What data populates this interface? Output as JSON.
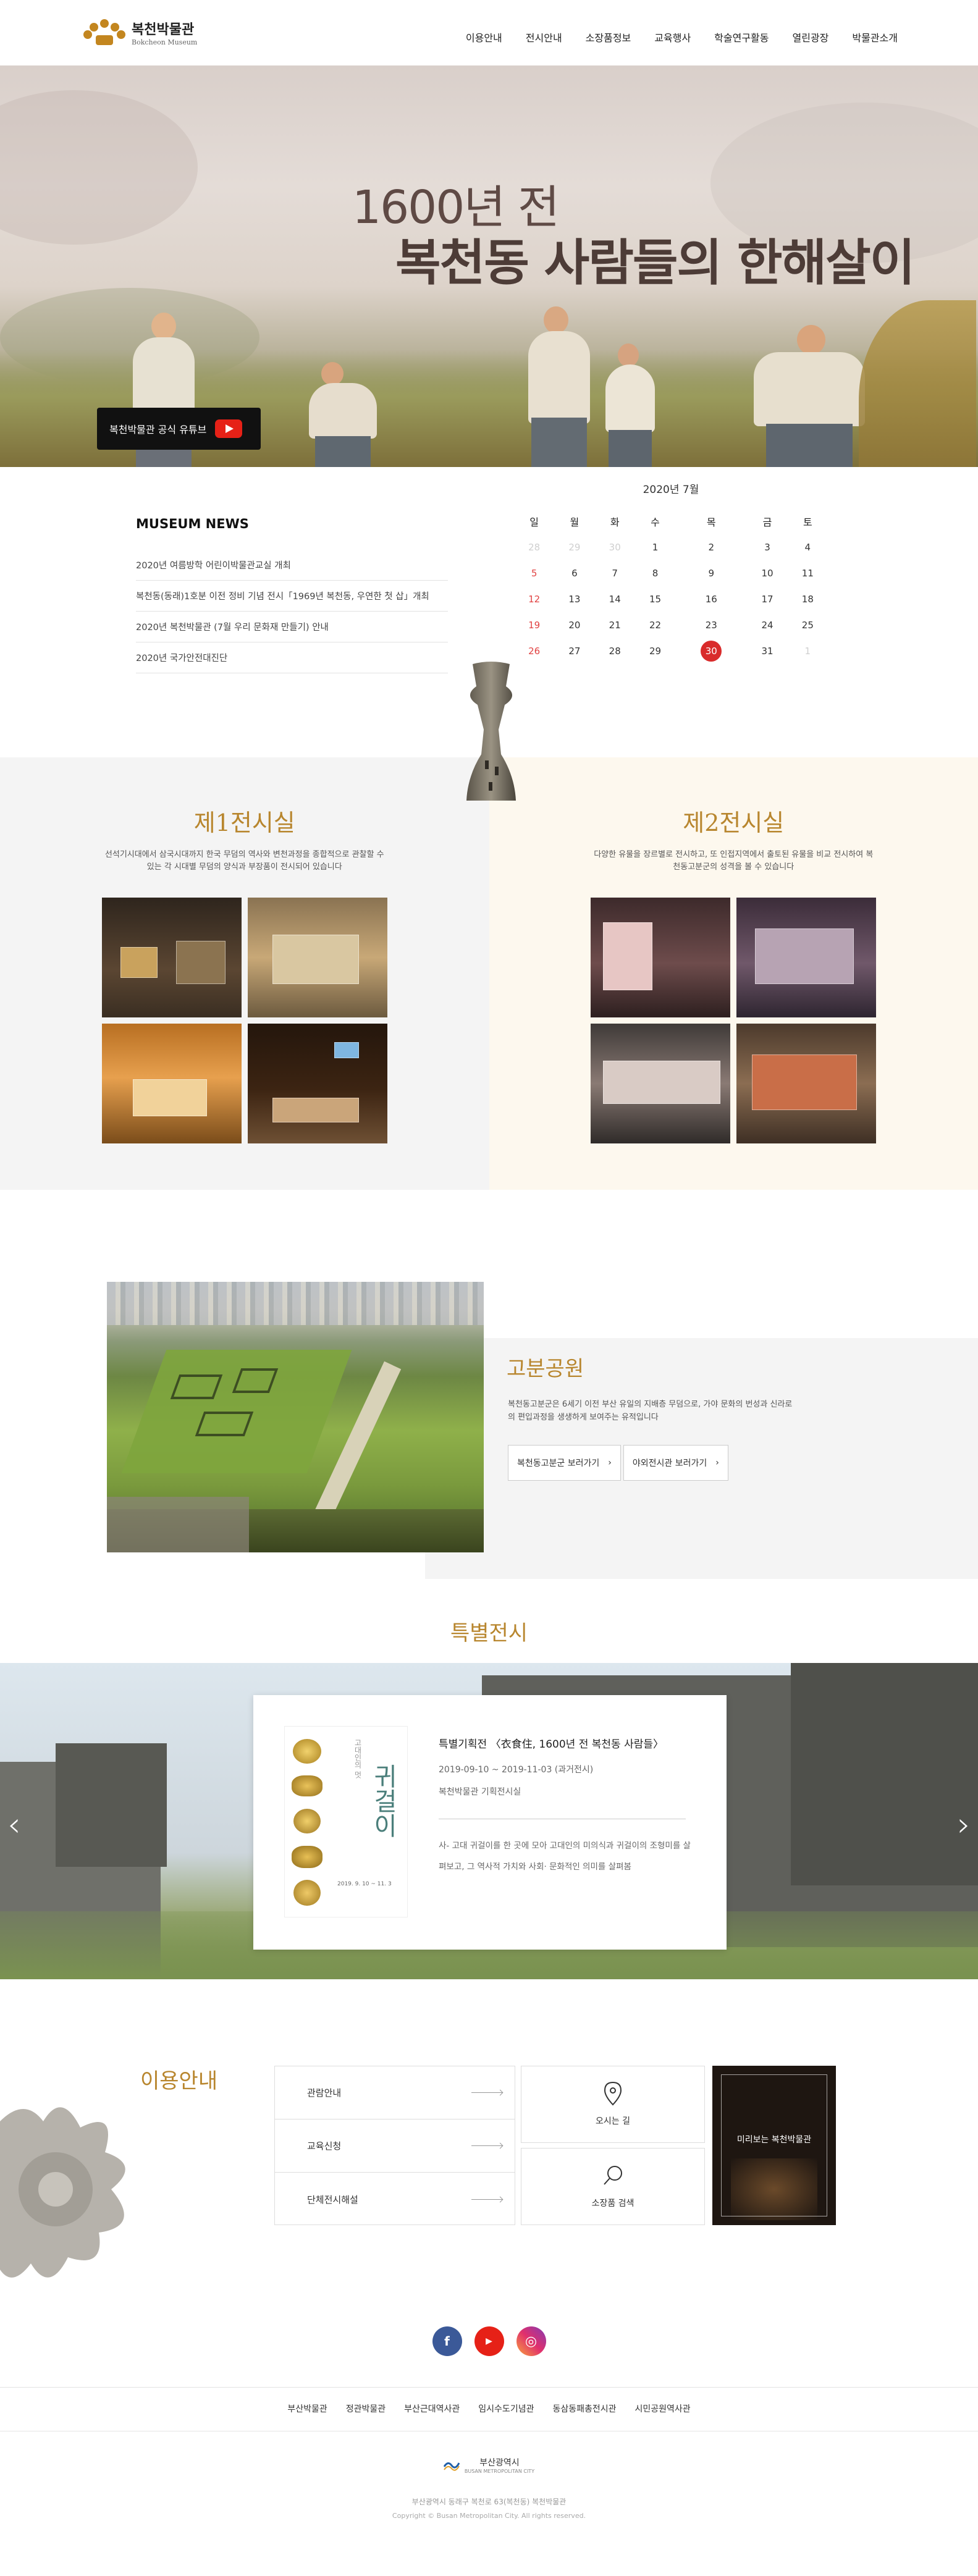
{
  "header": {
    "logo_name": "복천박물관",
    "logo_sub": "Bokcheon Museum",
    "nav": [
      "이용안내",
      "전시안내",
      "소장품정보",
      "교육행사",
      "학술연구활동",
      "열린광장",
      "박물관소개"
    ]
  },
  "hero": {
    "line1": "1600년 전",
    "line2": "복천동 사람들의 한해살이",
    "youtube_label": "복천박물관 공식 유튜브"
  },
  "news": {
    "title": "MUSEUM NEWS",
    "items": [
      "2020년 여름방학 어린이박물관교실 개최",
      "복천동(동래)1호분 이전 정비 기념 전시「1969년 복천동, 우연한 첫 삽」개최",
      "2020년 복천박물관 (7월 우리 문화재 만들기) 안내",
      "2020년 국가안전대진단"
    ]
  },
  "calendar": {
    "month_label": "2020년 7월",
    "weekdays": [
      "일",
      "월",
      "화",
      "수",
      "목",
      "금",
      "토"
    ],
    "weeks": [
      [
        "28",
        "29",
        "30",
        "1",
        "2",
        "3",
        "4"
      ],
      [
        "5",
        "6",
        "7",
        "8",
        "9",
        "10",
        "11"
      ],
      [
        "12",
        "13",
        "14",
        "15",
        "16",
        "17",
        "18"
      ],
      [
        "19",
        "20",
        "21",
        "22",
        "23",
        "24",
        "25"
      ],
      [
        "26",
        "27",
        "28",
        "29",
        "30",
        "31",
        "1"
      ]
    ],
    "today": "30"
  },
  "halls": {
    "hall1": {
      "title": "제1전시실",
      "desc": "선석기시대에서 삼국시대까지 한국 무덤의 역사와 변천과정을 종합적으로 관찰할 수 있는 각 시대별 무덤의 양식과 부장품이 전시되어 있습니다"
    },
    "hall2": {
      "title": "제2전시실",
      "desc": "다양한 유물을 장르별로 전시하고, 또 인접지역에서 출토된 유물을 비교 전시하여 복천동고분군의 성격을 볼 수 있습니다"
    }
  },
  "park": {
    "title": "고분공원",
    "desc": "복천동고분군은 6세기 이전 부산 유일의 지배층 무덤으로, 가야 문화의 번성과 신라로의 편입과정을 생생하게 보여주는 유적입니다",
    "btn1": "복천동고분군 보러가기",
    "btn2": "야외전시관 보러가기"
  },
  "special": {
    "heading": "특별전시",
    "title": "특별기획전 〈衣食住, 1600년 전 복천동 사람들〉",
    "date": "2019-09-10 ~ 2019-11-03 (과거전시)",
    "place": "복천박물관 기획전시실",
    "desc": "사- 고대 귀걸이를 한 곳에 모아 고대인의 미의식과 귀걸이의 조형미를 살펴보고, 그 역사적 가치와 사회· 문화적인 의미를 살펴봄",
    "poster_title": "귀걸이",
    "poster_top": "고대인의 멋",
    "poster_dates": "2019. 9. 10 ~ 11. 3",
    "prev_symbol": "‹",
    "next_symbol": "›"
  },
  "info": {
    "title": "이용안내",
    "links": [
      "관람안내",
      "교육신청",
      "단체전시해설"
    ],
    "directions": "오시는 길",
    "search": "소장품 검색",
    "video_label": "미리보는 복천박물관",
    "social": [
      "f",
      "▶",
      "◎"
    ]
  },
  "footer": {
    "links": [
      "부산박물관",
      "정관박물관",
      "부산근대역사관",
      "임시수도기념관",
      "동삼동패총전시관",
      "시민공원역사관"
    ],
    "city_label": "부산광역시",
    "city_sub": "BUSAN METROPOLITAN CITY",
    "address": "부산광역시 동래구 복천로 63(복천동) 복천박물관",
    "copyright": "Copyright © Busan Metropolitan City. All rights reserved."
  }
}
